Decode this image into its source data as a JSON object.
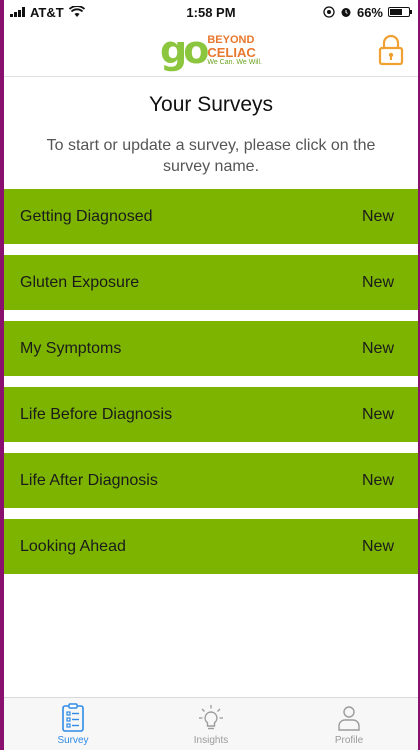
{
  "status_bar": {
    "carrier": "AT&T",
    "time": "1:58 PM",
    "battery": "66%",
    "battery_level": 0.66
  },
  "header": {
    "logo_go": "go",
    "logo_brand_line1": "BEYOND",
    "logo_brand_line2": "CELIAC",
    "logo_tagline": "We Can. We Will.",
    "lock_icon": "lock-icon",
    "accent_color": "#f0a030"
  },
  "main": {
    "title": "Your Surveys",
    "subtitle": "To start or update a survey, please click on the survey name.",
    "surveys": [
      {
        "name": "Getting Diagnosed",
        "status": "New"
      },
      {
        "name": "Gluten Exposure",
        "status": "New"
      },
      {
        "name": "My Symptoms",
        "status": "New"
      },
      {
        "name": "Life Before Diagnosis",
        "status": "New"
      },
      {
        "name": "Life After Diagnosis",
        "status": "New"
      },
      {
        "name": "Looking Ahead",
        "status": "New"
      }
    ],
    "item_color": "#7cb400"
  },
  "tab_bar": {
    "tabs": [
      {
        "label": "Survey",
        "icon": "clipboard-checklist-icon",
        "active": true
      },
      {
        "label": "Insights",
        "icon": "lightbulb-icon",
        "active": false
      },
      {
        "label": "Profile",
        "icon": "person-icon",
        "active": false
      }
    ],
    "active_color": "#2f8be6"
  }
}
